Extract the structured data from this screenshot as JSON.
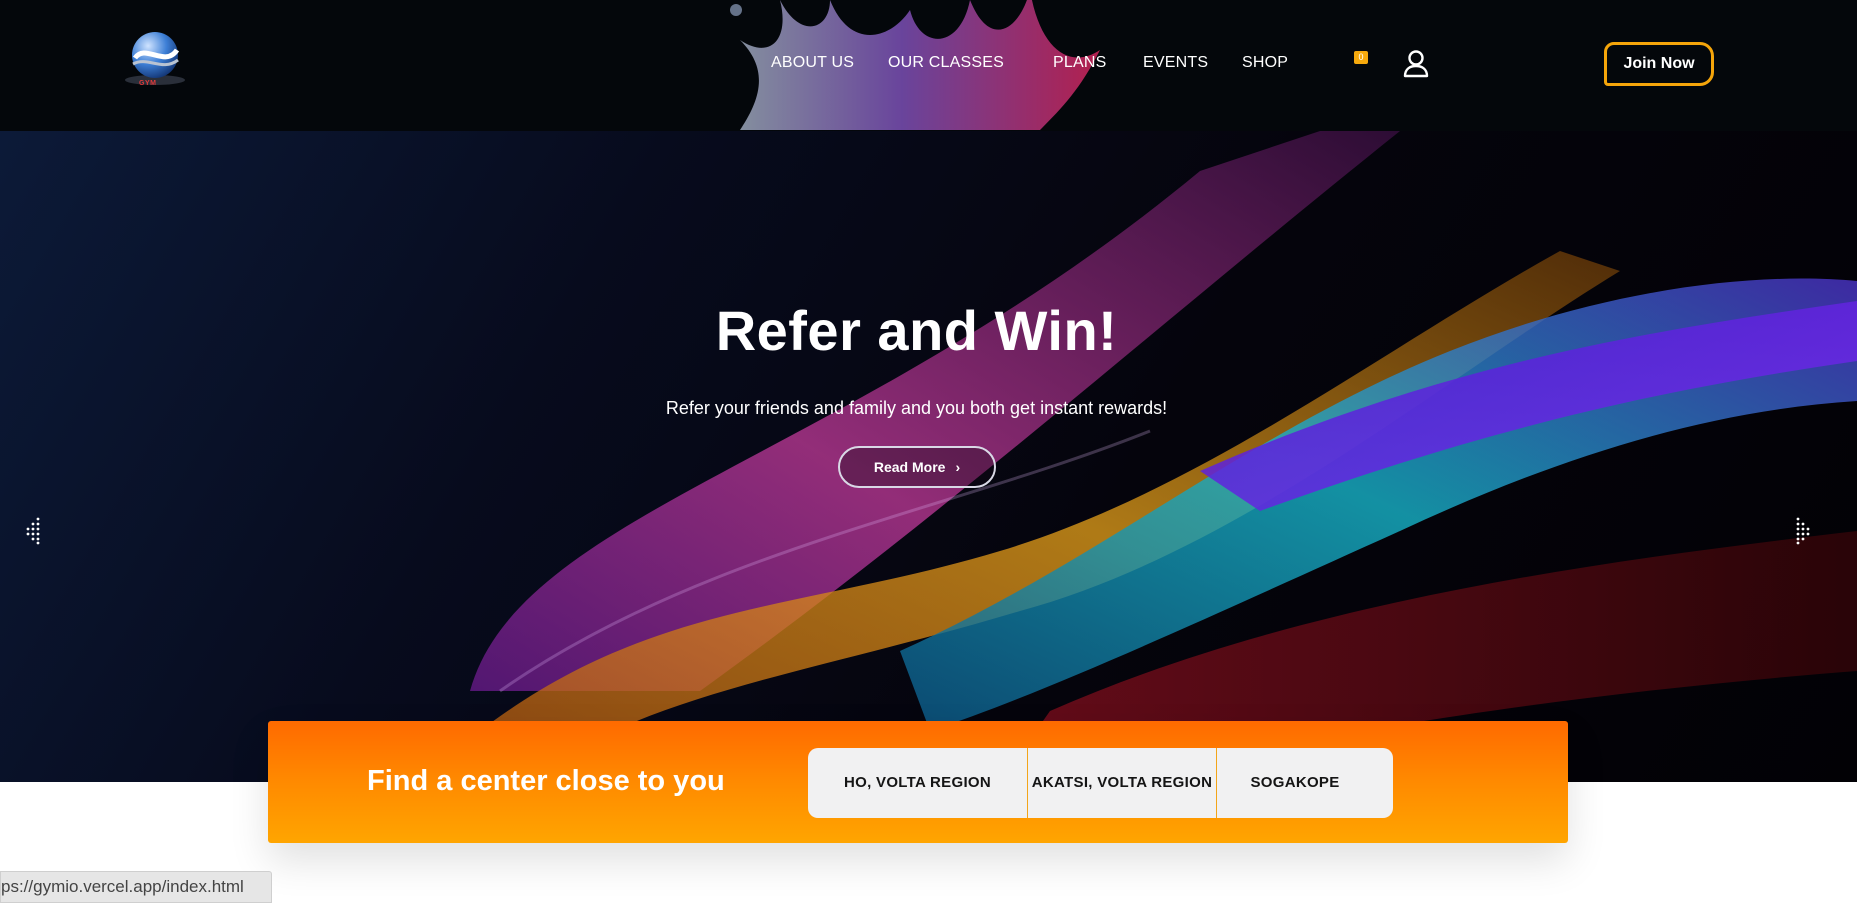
{
  "header": {
    "logo_text": "GYM",
    "nav": [
      {
        "label": "ABOUT US",
        "name": "nav-about-us"
      },
      {
        "label": "OUR CLASSES",
        "name": "nav-our-classes"
      },
      {
        "label": "PLANS",
        "name": "nav-plans"
      },
      {
        "label": "EVENTS",
        "name": "nav-events"
      },
      {
        "label": "SHOP",
        "name": "nav-shop"
      }
    ],
    "cart_count": "0",
    "join_label": "Join Now"
  },
  "hero": {
    "title": "Refer and Win!",
    "subtitle": "Refer your friends and family and you both get instant rewards!",
    "button_label": "Read More"
  },
  "locator": {
    "title": "Find a center close to you",
    "locations": [
      "HO, VOLTA REGION",
      "AKATSI, VOLTA REGION",
      "SOGAKOPE"
    ]
  },
  "status_bar": {
    "url": "ps://gymio.vercel.app/index.html"
  },
  "colors": {
    "accent": "#f5a50a",
    "locator_gradient_top": "#ff6a00",
    "locator_gradient_bottom": "#ffa500",
    "header_bg": "#04070b"
  },
  "icons": [
    "logo-globe-icon",
    "cart-icon",
    "user-icon",
    "arrow-left-icon",
    "arrow-right-icon",
    "chevron-right-icon",
    "chevron-down-icon"
  ]
}
